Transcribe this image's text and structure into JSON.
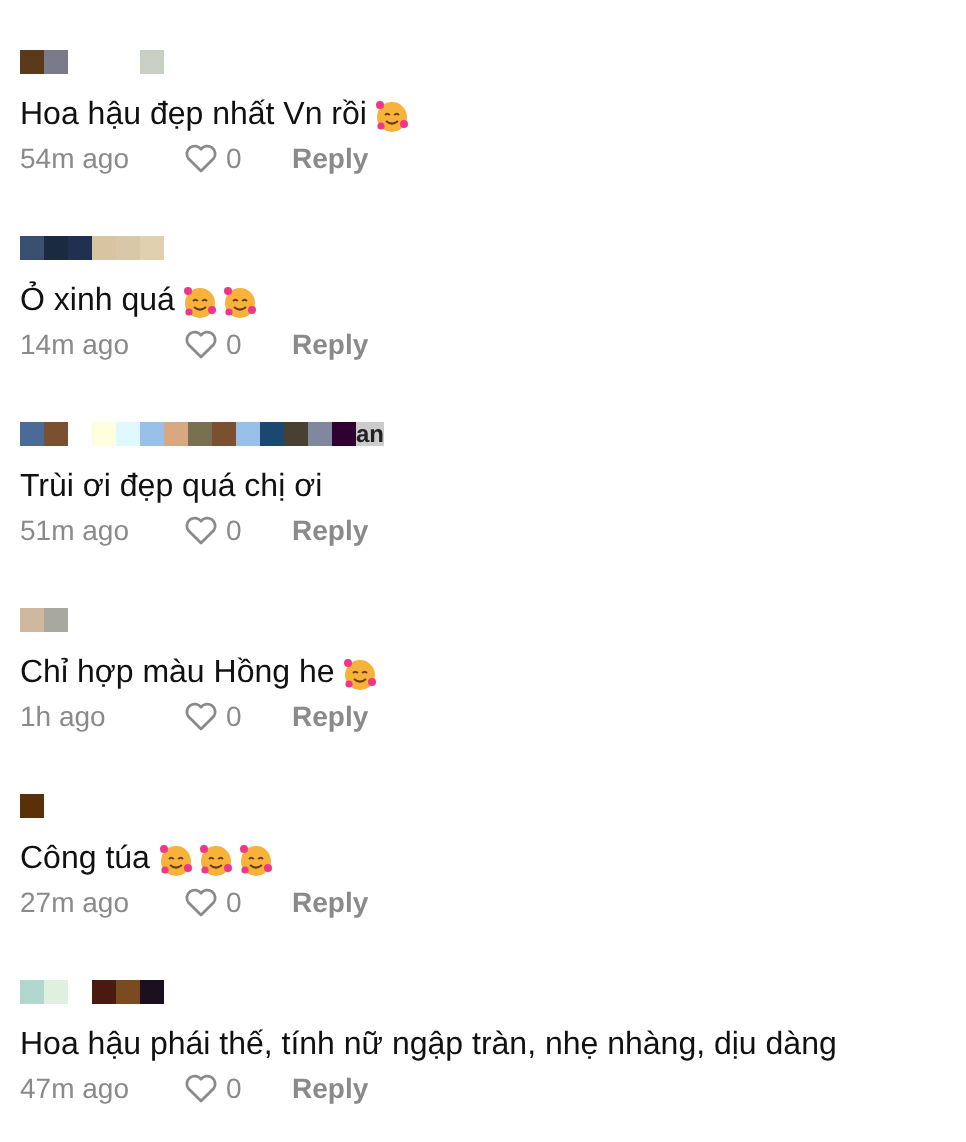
{
  "comments": [
    {
      "mosaic": [
        {
          "color": "#5a3a1a"
        },
        {
          "color": "#7a7a8a"
        },
        {
          "color": "#c8d0c4",
          "gap_before": true
        }
      ],
      "text": "Hoa hậu đẹp nhất Vn rồi",
      "emoji": [
        {
          "kind": "smiling-hearts"
        }
      ],
      "time": "54m ago",
      "likes": "0",
      "reply": "Reply"
    },
    {
      "mosaic": [
        {
          "color": "#3a5070"
        },
        {
          "color": "#1a2a40"
        },
        {
          "color": "#203050"
        },
        {
          "color": "#d8c4a0"
        },
        {
          "color": "#d8c8a8"
        },
        {
          "color": "#e0d0b0"
        }
      ],
      "text": "Ỏ xinh quá",
      "emoji": [
        {
          "kind": "smiling-hearts"
        },
        {
          "kind": "smiling-hearts"
        }
      ],
      "time": "14m ago",
      "likes": "0",
      "reply": "Reply"
    },
    {
      "mosaic": [
        {
          "color": "#4a6a98"
        },
        {
          "color": "#7a5030"
        },
        {
          "color": "#ffffe0",
          "gap_before": true
        },
        {
          "color": "#e0f8ff"
        },
        {
          "color": "#98c0e8"
        },
        {
          "color": "#d8a880"
        },
        {
          "color": "#787050"
        },
        {
          "color": "#7a5030"
        },
        {
          "color": "#98c0e8"
        },
        {
          "color": "#1a4870"
        },
        {
          "color": "#484030"
        },
        {
          "color": "#8088a0"
        },
        {
          "color": "#300030"
        }
      ],
      "name_tail": "an",
      "text": "Trùi ơi đẹp quá chị ơi",
      "time": "51m ago",
      "likes": "0",
      "reply": "Reply"
    },
    {
      "mosaic": [
        {
          "color": "#d0b8a0"
        },
        {
          "color": "#a8a8a0"
        }
      ],
      "text": "Chỉ hợp màu Hồng he",
      "emoji": [
        {
          "kind": "smiling-hearts"
        }
      ],
      "time": "1h ago",
      "likes": "0",
      "reply": "Reply"
    },
    {
      "mosaic": [
        {
          "color": "#5a3008"
        }
      ],
      "text": "Công túa",
      "emoji": [
        {
          "kind": "smiling-hearts"
        },
        {
          "kind": "smiling-hearts"
        },
        {
          "kind": "smiling-hearts"
        }
      ],
      "time": "27m ago",
      "likes": "0",
      "reply": "Reply"
    },
    {
      "mosaic": [
        {
          "color": "#b0d8d0"
        },
        {
          "color": "#e0f0e0"
        },
        {
          "color": "#4a1a10",
          "gap_before": true
        },
        {
          "color": "#7a4a20"
        },
        {
          "color": "#1a1020"
        }
      ],
      "text": "Hoa hậu phái thế, tính nữ ngập tràn, nhẹ nhàng, dịu dàng",
      "time": "47m ago",
      "likes": "0",
      "reply": "Reply"
    }
  ]
}
